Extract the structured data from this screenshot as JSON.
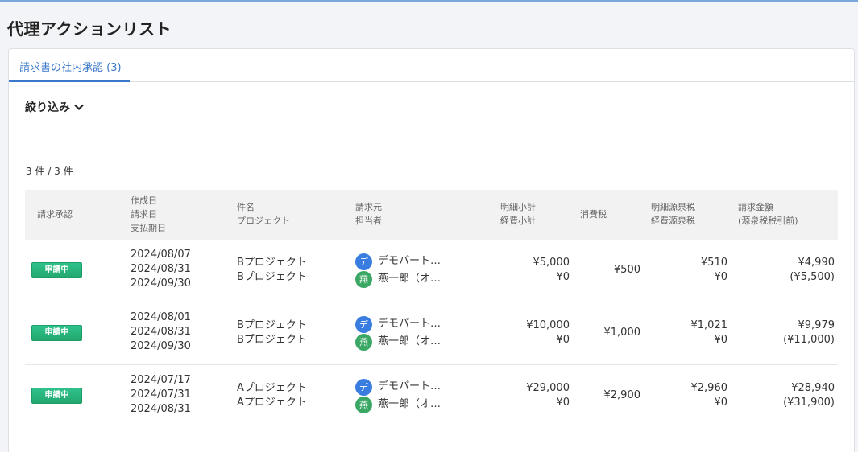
{
  "page": {
    "title": "代理アクションリスト"
  },
  "tabs": [
    {
      "label": "請求書の社内承認 (3)"
    }
  ],
  "filter": {
    "label": "絞り込み"
  },
  "count": {
    "text": "3 件 / 3 件"
  },
  "table": {
    "headers": {
      "approval": "請求承認",
      "dates": [
        "作成日",
        "請求日",
        "支払期日"
      ],
      "subject": [
        "件名",
        "プロジェクト"
      ],
      "party": [
        "請求元",
        "担当者"
      ],
      "subtotal": [
        "明細小計",
        "経費小計"
      ],
      "tax": "消費税",
      "withhold": [
        "明細源泉税",
        "経費源泉税"
      ],
      "total": [
        "請求金額",
        "(源泉税税引前)"
      ]
    },
    "rows": [
      {
        "status": "申請中",
        "created": "2024/08/07",
        "invoice_date": "2024/08/31",
        "due": "2024/09/30",
        "subject": "Bプロジェクト",
        "project": "Bプロジェクト",
        "sender_avatar": "デ",
        "sender": "デモパート…",
        "owner_avatar": "燕",
        "owner": "燕一郎（オ…",
        "item_subtotal": "¥5,000",
        "expense_subtotal": "¥0",
        "tax": "¥500",
        "item_withhold": "¥510",
        "expense_withhold": "¥0",
        "total": "¥4,990",
        "total_pre": "(¥5,500)"
      },
      {
        "status": "申請中",
        "created": "2024/08/01",
        "invoice_date": "2024/08/31",
        "due": "2024/09/30",
        "subject": "Bプロジェクト",
        "project": "Bプロジェクト",
        "sender_avatar": "デ",
        "sender": "デモパート…",
        "owner_avatar": "燕",
        "owner": "燕一郎（オ…",
        "item_subtotal": "¥10,000",
        "expense_subtotal": "¥0",
        "tax": "¥1,000",
        "item_withhold": "¥1,021",
        "expense_withhold": "¥0",
        "total": "¥9,979",
        "total_pre": "(¥11,000)"
      },
      {
        "status": "申請中",
        "created": "2024/07/17",
        "invoice_date": "2024/07/31",
        "due": "2024/08/31",
        "subject": "Aプロジェクト",
        "project": "Aプロジェクト",
        "sender_avatar": "デ",
        "sender": "デモパート…",
        "owner_avatar": "燕",
        "owner": "燕一郎（オ…",
        "item_subtotal": "¥29,000",
        "expense_subtotal": "¥0",
        "tax": "¥2,900",
        "item_withhold": "¥2,960",
        "expense_withhold": "¥0",
        "total": "¥28,940",
        "total_pre": "(¥31,900)"
      }
    ]
  },
  "colors": {
    "accent": "#3a78c9",
    "status_badge": "#23a86f",
    "avatar_sender": "#3a7de0",
    "avatar_owner": "#3aa765"
  },
  "icons": {
    "filter_toggle": "chevron-down-icon"
  }
}
